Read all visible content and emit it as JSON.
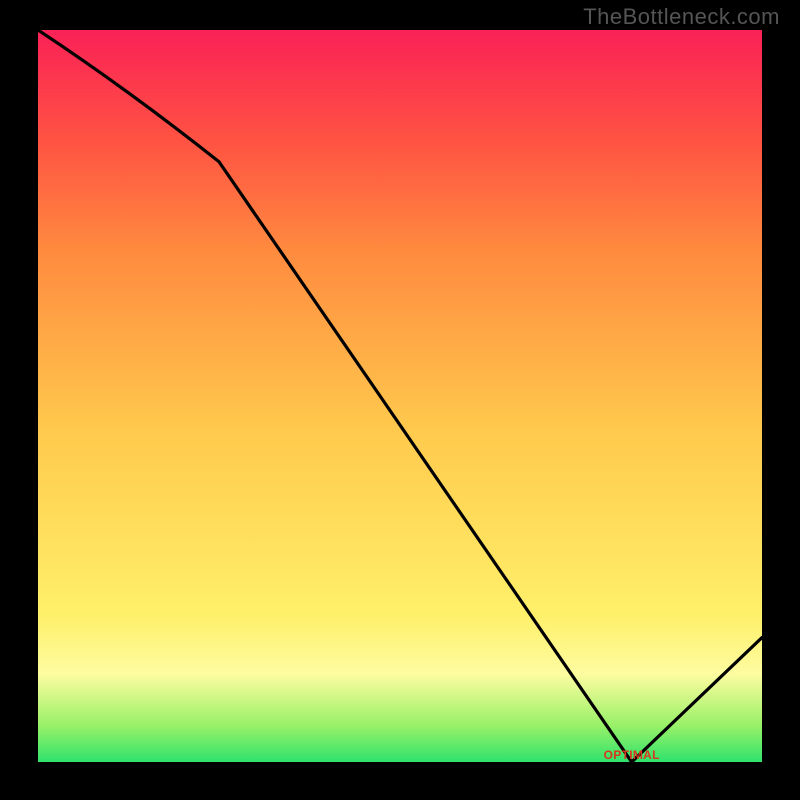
{
  "watermark": "TheBottleneck.com",
  "optimal_label": "OPTIMAL",
  "chart_data": {
    "type": "line",
    "title": "",
    "xlabel": "",
    "ylabel": "",
    "ylim": [
      0,
      100
    ],
    "x": [
      0,
      25,
      82,
      100
    ],
    "values": [
      100,
      82,
      0,
      17
    ],
    "optimal_x_range": [
      76,
      88
    ],
    "background": {
      "gradient": [
        {
          "stop": 0.0,
          "color": "#2fe26c"
        },
        {
          "stop": 0.05,
          "color": "#99f168"
        },
        {
          "stop": 0.12,
          "color": "#fdfca0"
        },
        {
          "stop": 0.2,
          "color": "#fff06a"
        },
        {
          "stop": 0.45,
          "color": "#ffca4d"
        },
        {
          "stop": 0.7,
          "color": "#ff8a3f"
        },
        {
          "stop": 0.85,
          "color": "#ff5243"
        },
        {
          "stop": 1.0,
          "color": "#fa2156"
        }
      ]
    }
  }
}
